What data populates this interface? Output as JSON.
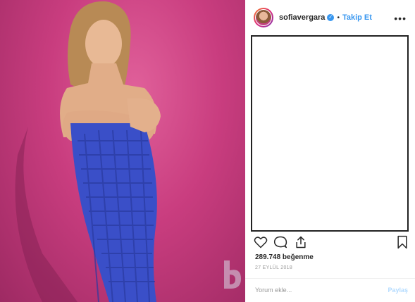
{
  "post": {
    "username": "sofiavergara",
    "separator": "•",
    "follow_label": "Takip Et",
    "more_label": "•••",
    "likes_text": "289.748 beğenme",
    "date_text": "27 EYLÜL 2018",
    "comment_placeholder": "Yorum ekle...",
    "post_label": "Paylaş"
  },
  "icons": {
    "verified": "verified-badge-icon",
    "like": "heart-icon",
    "comment": "comment-bubble-icon",
    "share": "share-icon",
    "save": "bookmark-icon",
    "more": "more-options-icon"
  },
  "colors": {
    "background_photo": "#c93d7f",
    "dress": "#3a4fc8",
    "link_blue": "#3897f0",
    "post_button_disabled": "#b3dbff"
  }
}
